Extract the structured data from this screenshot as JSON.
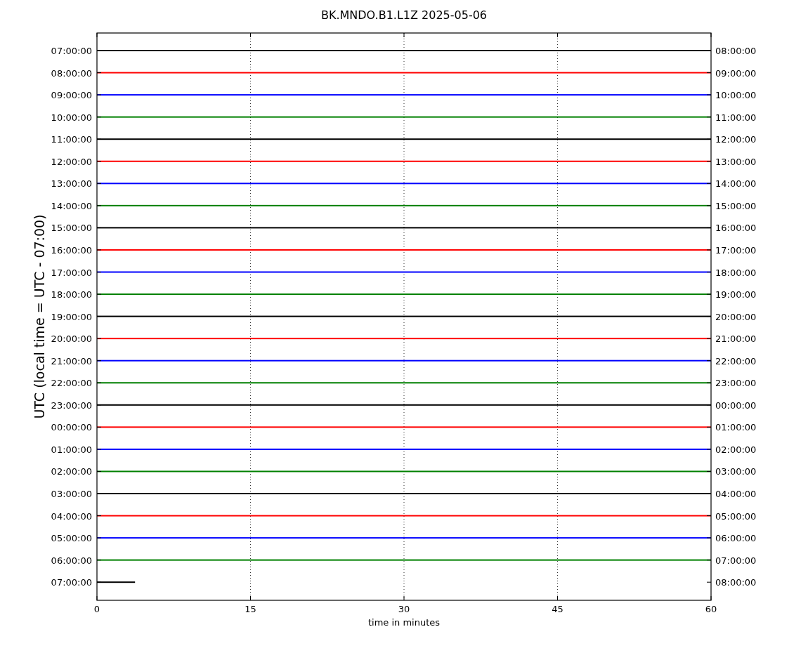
{
  "plot": {
    "title": "BK.MNDO.B1.L1Z 2025-05-06",
    "xlabel": "time in minutes",
    "ylabel": "UTC (local time = UTC - 07:00)",
    "xticks": [
      "0",
      "15",
      "30",
      "45",
      "60"
    ],
    "rows": [
      {
        "left": "07:00:00",
        "right": "08:00:00",
        "color": "#000000",
        "level": 1
      },
      {
        "left": "08:00:00",
        "right": "09:00:00",
        "color": "#ff0000",
        "level": 1
      },
      {
        "left": "09:00:00",
        "right": "10:00:00",
        "color": "#0000ff",
        "level": 1
      },
      {
        "left": "10:00:00",
        "right": "11:00:00",
        "color": "#008000",
        "level": 1
      },
      {
        "left": "11:00:00",
        "right": "12:00:00",
        "color": "#000000",
        "level": 1
      },
      {
        "left": "12:00:00",
        "right": "13:00:00",
        "color": "#ff0000",
        "level": 1
      },
      {
        "left": "13:00:00",
        "right": "14:00:00",
        "color": "#0000ff",
        "level": 1
      },
      {
        "left": "14:00:00",
        "right": "15:00:00",
        "color": "#008000",
        "level": 1
      },
      {
        "left": "15:00:00",
        "right": "16:00:00",
        "color": "#000000",
        "level": 1
      },
      {
        "left": "16:00:00",
        "right": "17:00:00",
        "color": "#ff0000",
        "level": 1
      },
      {
        "left": "17:00:00",
        "right": "18:00:00",
        "color": "#0000ff",
        "level": 1
      },
      {
        "left": "18:00:00",
        "right": "19:00:00",
        "color": "#008000",
        "level": 1
      },
      {
        "left": "19:00:00",
        "right": "20:00:00",
        "color": "#000000",
        "level": 1
      },
      {
        "left": "20:00:00",
        "right": "21:00:00",
        "color": "#ff0000",
        "level": 1
      },
      {
        "left": "21:00:00",
        "right": "22:00:00",
        "color": "#0000ff",
        "level": 1
      },
      {
        "left": "22:00:00",
        "right": "23:00:00",
        "color": "#008000",
        "level": 1
      },
      {
        "left": "23:00:00",
        "right": "00:00:00",
        "color": "#000000",
        "level": 1
      },
      {
        "left": "00:00:00",
        "right": "01:00:00",
        "color": "#ff0000",
        "level": 1
      },
      {
        "left": "01:00:00",
        "right": "02:00:00",
        "color": "#0000ff",
        "level": 1
      },
      {
        "left": "02:00:00",
        "right": "03:00:00",
        "color": "#008000",
        "level": 1
      },
      {
        "left": "03:00:00",
        "right": "04:00:00",
        "color": "#000000",
        "level": 1
      },
      {
        "left": "04:00:00",
        "right": "05:00:00",
        "color": "#ff0000",
        "level": 1
      },
      {
        "left": "05:00:00",
        "right": "06:00:00",
        "color": "#0000ff",
        "level": 1
      },
      {
        "left": "06:00:00",
        "right": "07:00:00",
        "color": "#008000",
        "level": 1
      },
      {
        "left": "07:00:00",
        "right": "08:00:00",
        "color": "#000000",
        "level": 0.062
      }
    ]
  }
}
